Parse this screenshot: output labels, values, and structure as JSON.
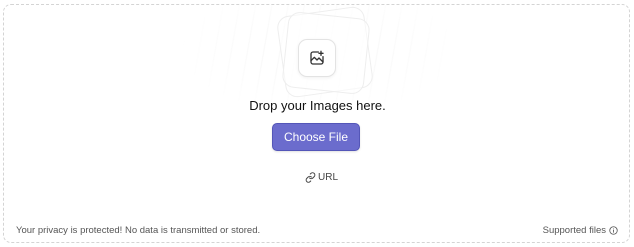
{
  "dropzone": {
    "title": "Drop your Images here.",
    "choose_button_label": "Choose File",
    "url_label": "URL",
    "privacy_text": "Your privacy is protected! No data is transmitted or stored.",
    "supported_label": "Supported files",
    "icons": {
      "upload": "image-plus-icon",
      "url": "link-icon",
      "supported": "info-icon"
    },
    "colors": {
      "button_bg": "#6b6ccd",
      "button_text": "#ffffff",
      "border": "#d4d4d4"
    }
  }
}
